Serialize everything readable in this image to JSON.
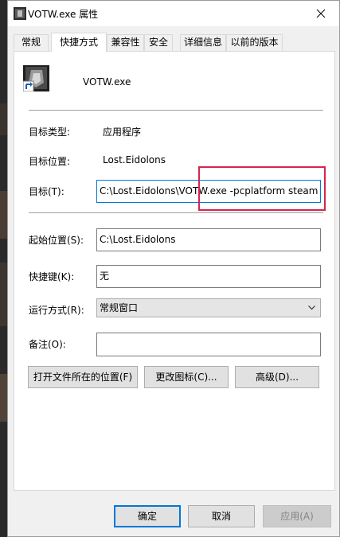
{
  "window": {
    "title": "VOTW.exe 属性"
  },
  "tabs": [
    {
      "label": "常规"
    },
    {
      "label": "快捷方式"
    },
    {
      "label": "兼容性"
    },
    {
      "label": "安全"
    },
    {
      "label": "详细信息"
    },
    {
      "label": "以前的版本"
    }
  ],
  "active_tab": "快捷方式",
  "shortcut": {
    "name": "VOTW.exe",
    "target_type_label": "目标类型:",
    "target_type_value": "应用程序",
    "target_location_label": "目标位置:",
    "target_location_value": "Lost.Eidolons",
    "target_label": "目标(T):",
    "target_value": "C:\\Lost.Eidolons\\VOTW.exe -pcplatform steam",
    "start_in_label": "起始位置(S):",
    "start_in_value": "C:\\Lost.Eidolons",
    "hotkey_label": "快捷键(K):",
    "hotkey_value": "无",
    "run_label": "运行方式(R):",
    "run_value": "常规窗口",
    "comment_label": "备注(O):",
    "comment_value": ""
  },
  "buttons": {
    "open_location": "打开文件所在的位置(F)",
    "change_icon": "更改图标(C)...",
    "advanced": "高级(D)...",
    "ok": "确定",
    "cancel": "取消",
    "apply": "应用(A)"
  },
  "icons": {
    "app_icon": "app-shortcut-icon",
    "close": "close-icon",
    "dropdown": "chevron-down-icon"
  }
}
